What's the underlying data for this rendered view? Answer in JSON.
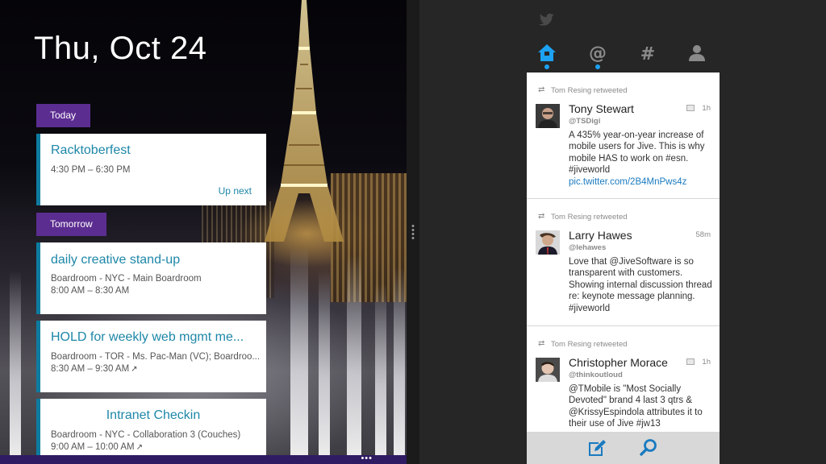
{
  "calendar": {
    "date_title": "Thu, Oct 24",
    "today_label": "Today",
    "tomorrow_label": "Tomorrow",
    "events": [
      {
        "title": "Racktoberfest",
        "location": "",
        "time": "4:30 PM – 6:30 PM",
        "badge": "Up next"
      },
      {
        "title": "daily creative stand-up",
        "location": "Boardroom - NYC - Main Boardroom",
        "time": "8:00 AM – 8:30 AM"
      },
      {
        "title": "HOLD for weekly web mgmt me...",
        "location": "Boardroom - TOR - Ms. Pac-Man (VC); Boardroo...",
        "time": "8:30 AM – 9:30 AM"
      },
      {
        "title": "Intranet Checkin",
        "location": "Boardroom - NYC - Collaboration 3 (Couches)",
        "time": "9:00 AM – 10:00 AM"
      }
    ],
    "app_bar_more": "•••",
    "accent_color": "#5c2d91",
    "event_bar_color": "#0f7ba0"
  },
  "twitter": {
    "nav_tabs": [
      {
        "icon": "home-icon",
        "active": true,
        "has_dot": true
      },
      {
        "icon": "mentions-icon",
        "active": false,
        "has_dot": true
      },
      {
        "icon": "hashtag-icon",
        "active": false,
        "has_dot": false
      },
      {
        "icon": "profile-icon",
        "active": false,
        "has_dot": false
      }
    ],
    "tweets": [
      {
        "retweeted_by": "Tom Resing retweeted",
        "author": "Tony Stewart",
        "handle": "@TSDigi",
        "time": "1h",
        "has_media": true,
        "body_lines": [
          "A 435% year-on-year increase of",
          "mobile users for Jive. This is why",
          "mobile HAS to work on #esn.",
          "#jiveworld"
        ],
        "link": "pic.twitter.com/2B4MnPws4z"
      },
      {
        "retweeted_by": "Tom Resing retweeted",
        "author": "Larry Hawes",
        "handle": "@lehawes",
        "time": "58m",
        "has_media": false,
        "body_lines": [
          "Love that @JiveSoftware is so",
          "transparent with customers.",
          "Showing internal discussion thread",
          "re: keynote message planning.",
          "#jiveworld"
        ],
        "link": ""
      },
      {
        "retweeted_by": "Tom Resing retweeted",
        "author": "Christopher Morace",
        "handle": "@thinkoutloud",
        "time": "1h",
        "has_media": true,
        "body_lines": [
          "@TMobile is \"Most Socially",
          "Devoted\" brand 4 last 3 qtrs &",
          "@KrissyEspindola attributes it to",
          "their use of Jive #jw13"
        ],
        "link": ""
      }
    ],
    "accent_color": "#1da1f2"
  }
}
